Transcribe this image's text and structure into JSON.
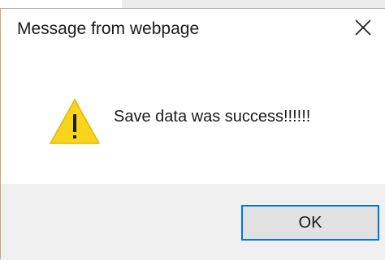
{
  "dialog": {
    "title": "Message from webpage",
    "close_icon": "close-icon",
    "message": "Save data was success!!!!!!",
    "icon": "warning-icon",
    "icon_color": "#f7d51b",
    "ok_label": "OK",
    "accent_color": "#0078d7"
  }
}
